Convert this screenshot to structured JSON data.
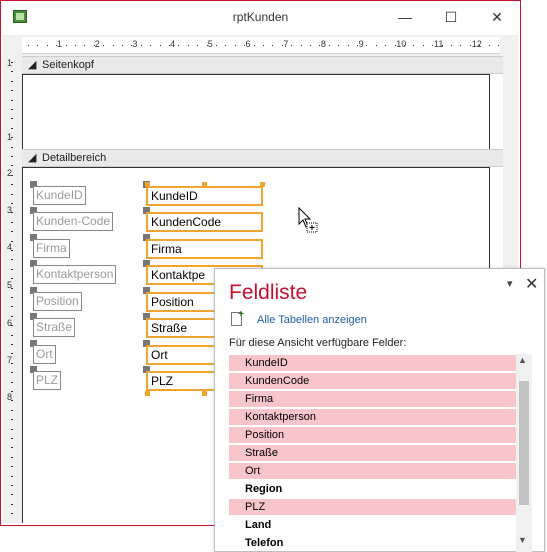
{
  "window": {
    "title": "rptKunden",
    "minimize": "—",
    "maximize": "☐",
    "close": "✕"
  },
  "ruler": {
    "top_labels": [
      "1",
      "2",
      "3",
      "4",
      "5",
      "6",
      "7",
      "8",
      "9",
      "10",
      "11",
      "12"
    ],
    "left_labels": [
      "1",
      "1",
      "2",
      "3",
      "4",
      "5",
      "6",
      "7",
      "8"
    ]
  },
  "sections": {
    "header": "Seitenkopf",
    "detail": "Detailbereich",
    "arrow": "◢"
  },
  "labels": [
    "KundeID",
    "Kunden-Code",
    "Firma",
    "Kontaktperson",
    "Position",
    "Straße",
    "Ort",
    "PLZ"
  ],
  "textboxes": [
    "KundeID",
    "KundenCode",
    "Firma",
    "Kontaktpe",
    "Position",
    "Straße",
    "Ort",
    "PLZ"
  ],
  "colors": {
    "accent": "#c8102e",
    "selection": "#f2a431",
    "used_field": "#f8c5cb"
  },
  "fieldlist": {
    "title": "Feldliste",
    "dropdown": "▾",
    "close": "✕",
    "show_all_link": "Alle Tabellen anzeigen",
    "available_label": "Für diese Ansicht verfügbare Felder:",
    "fields": [
      {
        "name": "KundeID",
        "used": true
      },
      {
        "name": "KundenCode",
        "used": true
      },
      {
        "name": "Firma",
        "used": true
      },
      {
        "name": "Kontaktperson",
        "used": true
      },
      {
        "name": "Position",
        "used": true
      },
      {
        "name": "Straße",
        "used": true
      },
      {
        "name": "Ort",
        "used": true
      },
      {
        "name": "Region",
        "used": false
      },
      {
        "name": "PLZ",
        "used": true
      },
      {
        "name": "Land",
        "used": false
      },
      {
        "name": "Telefon",
        "used": false
      }
    ],
    "scroll_up": "▲",
    "scroll_down": "▼"
  },
  "cursor_icon": "drag-copy-cursor-icon"
}
